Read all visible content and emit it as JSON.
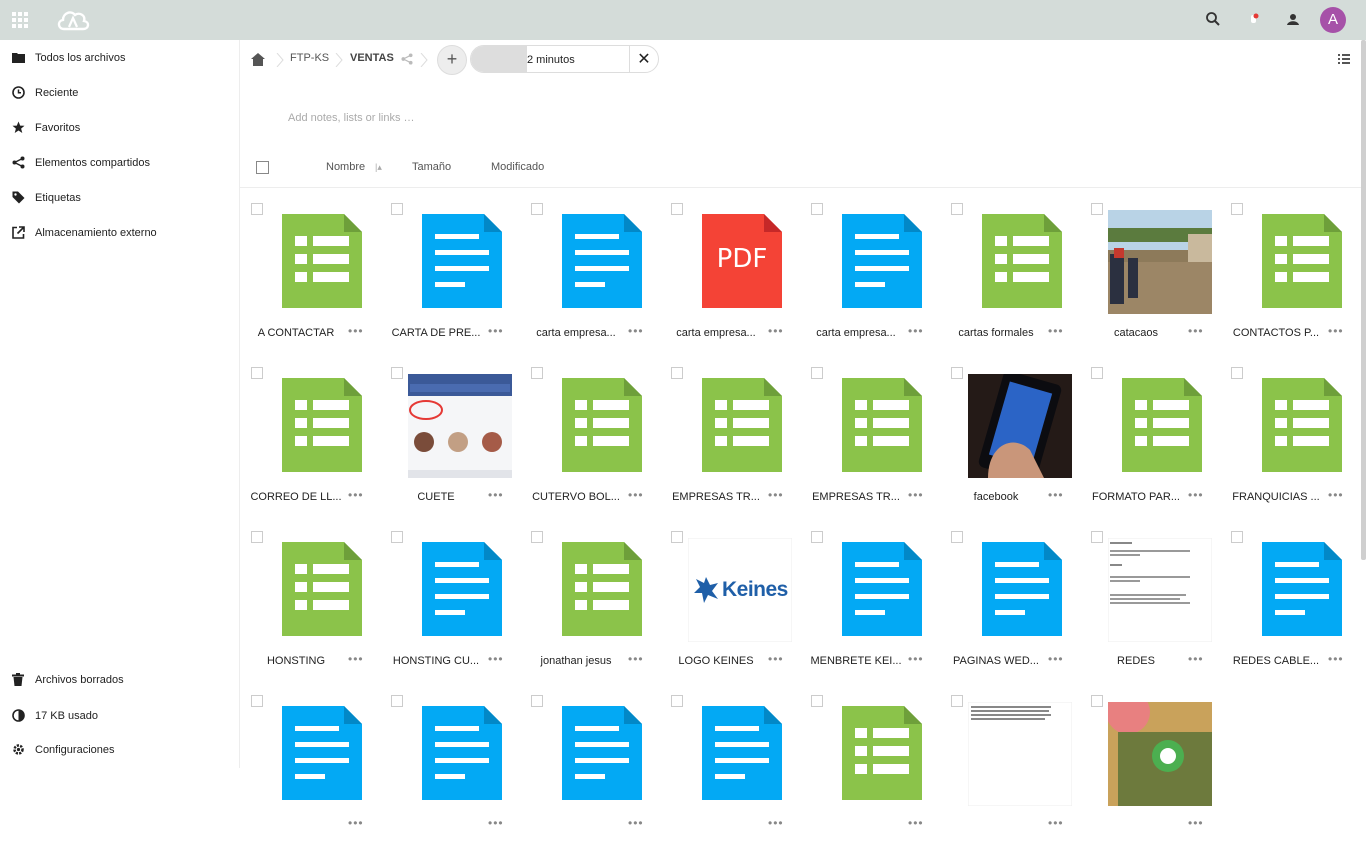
{
  "header": {
    "avatar_letter": "A",
    "brand_color": "#d4dcd9",
    "avatar_color": "#a651a8"
  },
  "sidebar": {
    "items": [
      {
        "label": "Todos los archivos",
        "icon": "folder-icon"
      },
      {
        "label": "Reciente",
        "icon": "clock-icon"
      },
      {
        "label": "Favoritos",
        "icon": "star-icon"
      },
      {
        "label": "Elementos compartidos",
        "icon": "share-icon"
      },
      {
        "label": "Etiquetas",
        "icon": "tag-icon"
      },
      {
        "label": "Almacenamiento externo",
        "icon": "external-icon"
      }
    ],
    "bottom": [
      {
        "label": "Archivos borrados",
        "icon": "trash-icon"
      },
      {
        "label": "17 KB usado",
        "icon": "quota-icon"
      },
      {
        "label": "Configuraciones",
        "icon": "gear-icon"
      }
    ]
  },
  "breadcrumb": {
    "items": [
      "FTP-KS",
      "VENTAS"
    ]
  },
  "upload": {
    "status": "2 minutos",
    "progress": 0.3
  },
  "notes_placeholder": "Add notes, lists or links …",
  "columns": {
    "name": "Nombre",
    "size": "Tamaño",
    "modified": "Modificado"
  },
  "files": [
    {
      "name": "A CONTACTAR",
      "type": "sheet"
    },
    {
      "name": "CARTA DE PRE...",
      "type": "doc"
    },
    {
      "name": "carta empresa...",
      "type": "doc"
    },
    {
      "name": "carta empresa...",
      "type": "pdf"
    },
    {
      "name": "carta empresa...",
      "type": "doc"
    },
    {
      "name": "cartas formales",
      "type": "sheet"
    },
    {
      "name": "catacaos",
      "type": "photo-flood"
    },
    {
      "name": "CONTACTOS P...",
      "type": "sheet"
    },
    {
      "name": "CORREO DE LL...",
      "type": "sheet"
    },
    {
      "name": "CUETE",
      "type": "photo-app"
    },
    {
      "name": "CUTERVO BOL...",
      "type": "sheet"
    },
    {
      "name": "EMPRESAS TR...",
      "type": "sheet"
    },
    {
      "name": "EMPRESAS TR...",
      "type": "sheet"
    },
    {
      "name": "facebook",
      "type": "photo-phone"
    },
    {
      "name": "FORMATO PAR...",
      "type": "sheet"
    },
    {
      "name": "FRANQUICIAS ...",
      "type": "sheet"
    },
    {
      "name": "HONSTING",
      "type": "sheet"
    },
    {
      "name": "HONSTING CU...",
      "type": "doc"
    },
    {
      "name": "jonathan jesus",
      "type": "sheet"
    },
    {
      "name": "LOGO KEINES",
      "type": "logo"
    },
    {
      "name": "MENBRETE KEI...",
      "type": "doc"
    },
    {
      "name": "PAGINAS WED...",
      "type": "doc"
    },
    {
      "name": "REDES",
      "type": "text-preview"
    },
    {
      "name": "REDES CABLE...",
      "type": "doc"
    },
    {
      "name": "",
      "type": "doc"
    },
    {
      "name": "",
      "type": "doc"
    },
    {
      "name": "",
      "type": "doc"
    },
    {
      "name": "",
      "type": "doc"
    },
    {
      "name": "",
      "type": "sheet"
    },
    {
      "name": "",
      "type": "text-preview2"
    },
    {
      "name": "",
      "type": "photo-whatsapp"
    }
  ],
  "logo_text": "Keines",
  "pdf_label": "PDF",
  "colors": {
    "sheet": "#8bc34a",
    "doc": "#03a9f4",
    "pdf": "#f44336"
  }
}
